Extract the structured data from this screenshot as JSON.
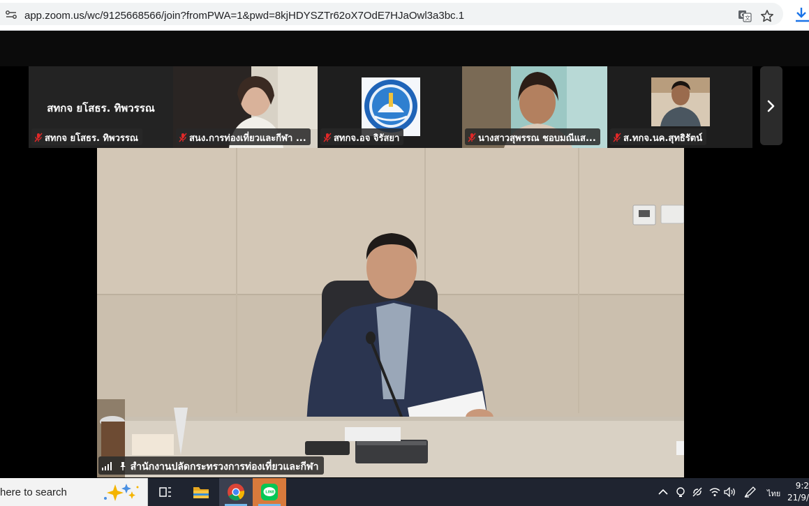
{
  "browser": {
    "url": "app.zoom.us/wc/9125668566/join?fromPWA=1&pwd=8kjHDYSZTr62oX7OdE7HJaOwl3a3bc.1"
  },
  "gallery": {
    "tiles": [
      {
        "display_name": "สทกจ ยโสธร. ทิพวรรณ",
        "label": "สทกจ ยโสธร. ทิพวรรณ",
        "muted": true,
        "type": "name-only"
      },
      {
        "label": "สนง.การท่องเที่ยวและกีฬา ...",
        "muted": true,
        "type": "video"
      },
      {
        "label": "สทกจ.อจ จิรัสยา",
        "muted": true,
        "type": "logo"
      },
      {
        "label": "นางสาวสุพรรณ ชอบมณีแส...",
        "muted": true,
        "type": "video"
      },
      {
        "label": "ส.ทกจ.นค.สุทธิรัตน์",
        "muted": true,
        "type": "video"
      }
    ]
  },
  "main_video": {
    "speaker_label": "สำนักงานปลัดกระทรวงการท่องเที่ยวและกีฬา"
  },
  "taskbar": {
    "search_placeholder": "here to search",
    "input_indicator": "ไทย",
    "time": "9:2",
    "date": "21/9/"
  },
  "colors": {
    "zoom_bg": "#0b0b0b",
    "tile_bg": "#232323",
    "mute_red": "#e02828",
    "taskbar_bg": "#1f2430"
  },
  "icons": [
    "site-info-icon",
    "translate-icon",
    "star-icon",
    "download-icon",
    "mic-muted-icon",
    "chevron-right-icon",
    "signal-icon",
    "pin-icon",
    "search-sparkle-icon",
    "task-view-icon",
    "file-explorer-icon",
    "chrome-icon",
    "line-app-icon",
    "chevron-up-icon",
    "wifi-icon",
    "volume-icon",
    "pen-icon"
  ]
}
